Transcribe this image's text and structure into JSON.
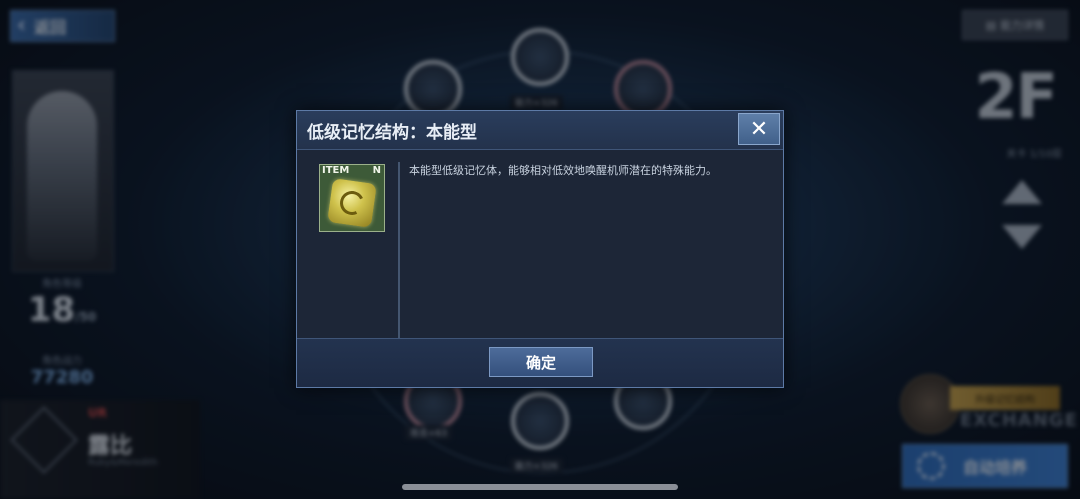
{
  "topbar": {
    "back_label": "返回",
    "power_detail_label": "能力详情"
  },
  "character": {
    "level_caption": "角色等级",
    "level": "18",
    "level_max": "/50",
    "power_caption": "角色战力",
    "power": "77280",
    "rank": "UR",
    "name": "露比",
    "name_en": "Ruby&Meredith"
  },
  "memory_nodes": [
    "能力+326",
    "能力+326",
    "攻击+63"
  ],
  "floor": {
    "value": "2F",
    "sub": "关卡 1/10层"
  },
  "exchange": {
    "tag": "升级记忆结构",
    "word": "EXCHANGE"
  },
  "auto_button": {
    "label": "自动培养"
  },
  "modal": {
    "title": "低级记忆结构：本能型",
    "close_glyph": "✕",
    "item_tag": "ITEM",
    "item_rarity": "N",
    "description": "本能型低级记忆体，能够相对低效地唤醒机师潜在的特殊能力。",
    "confirm_label": "确定"
  },
  "colors": {
    "modal_bg": "#1c2638",
    "accent": "#5d7aa6",
    "item_bg": "#3d5a38"
  }
}
